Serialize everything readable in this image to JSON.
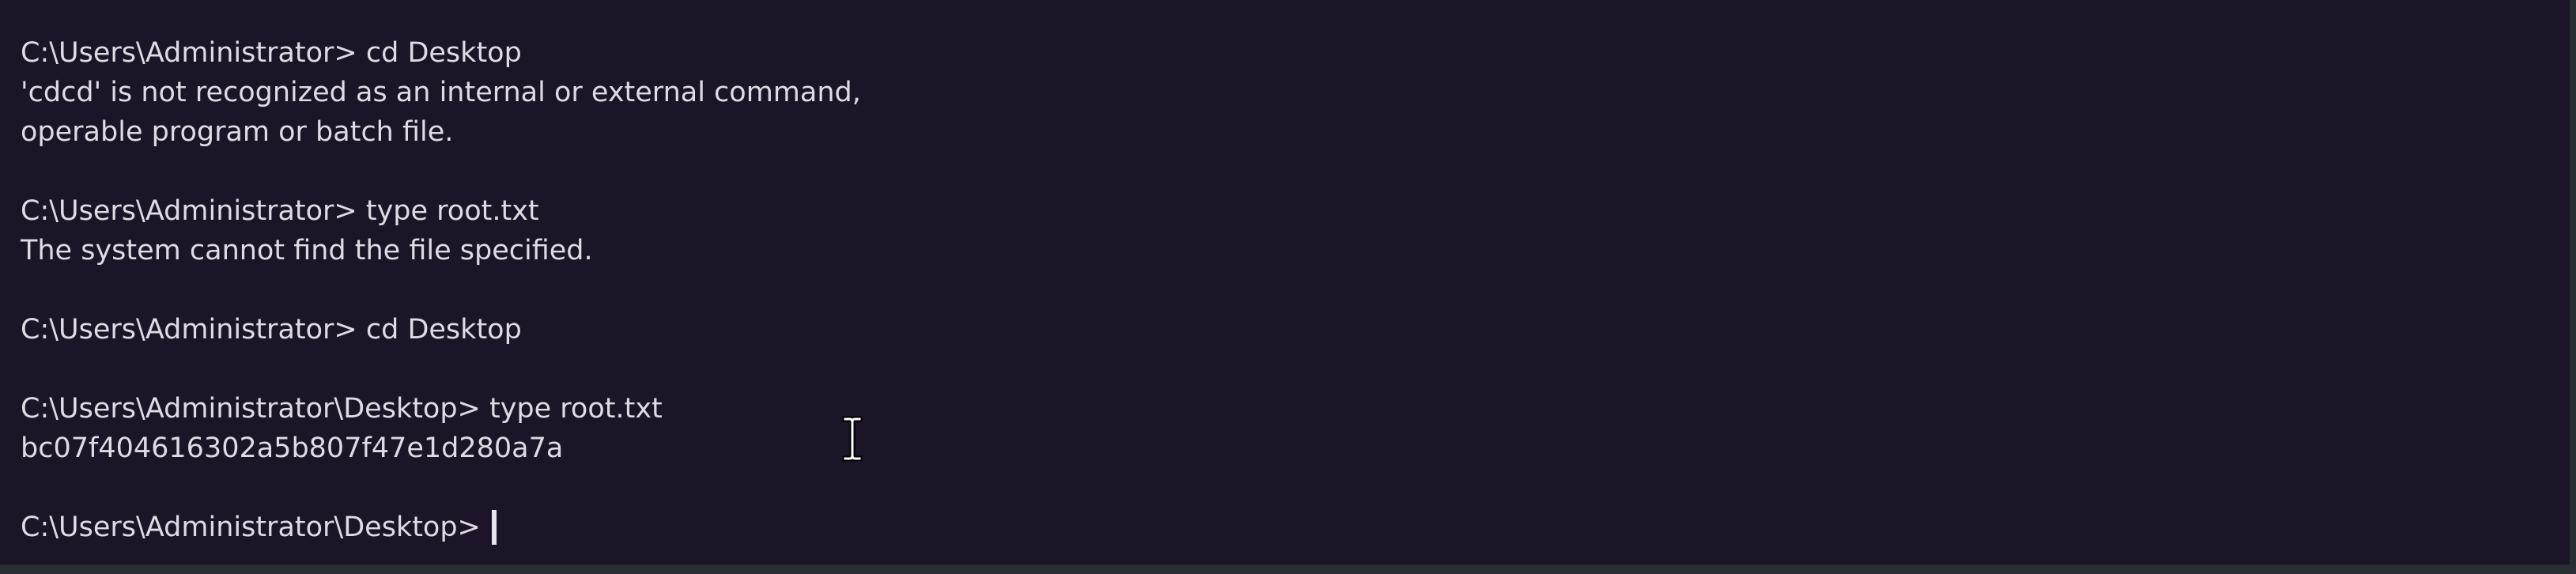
{
  "terminal": {
    "lines": [
      "C:\\Users\\Administrator> cd Desktop",
      "'cdcd' is not recognized as an internal or external command,",
      "operable program or batch file.",
      "",
      "C:\\Users\\Administrator> type root.txt",
      "The system cannot find the file specified.",
      "",
      "C:\\Users\\Administrator> cd Desktop",
      "",
      "C:\\Users\\Administrator\\Desktop> type root.txt",
      "bc07f404616302a5b807f47e1d280a7a",
      ""
    ],
    "prompt": "C:\\Users\\Administrator\\Desktop>"
  },
  "colors": {
    "background": "#1b1527",
    "text": "#dedbe4"
  },
  "icons": {
    "pointer": "text-cursor-ibeam-icon"
  }
}
